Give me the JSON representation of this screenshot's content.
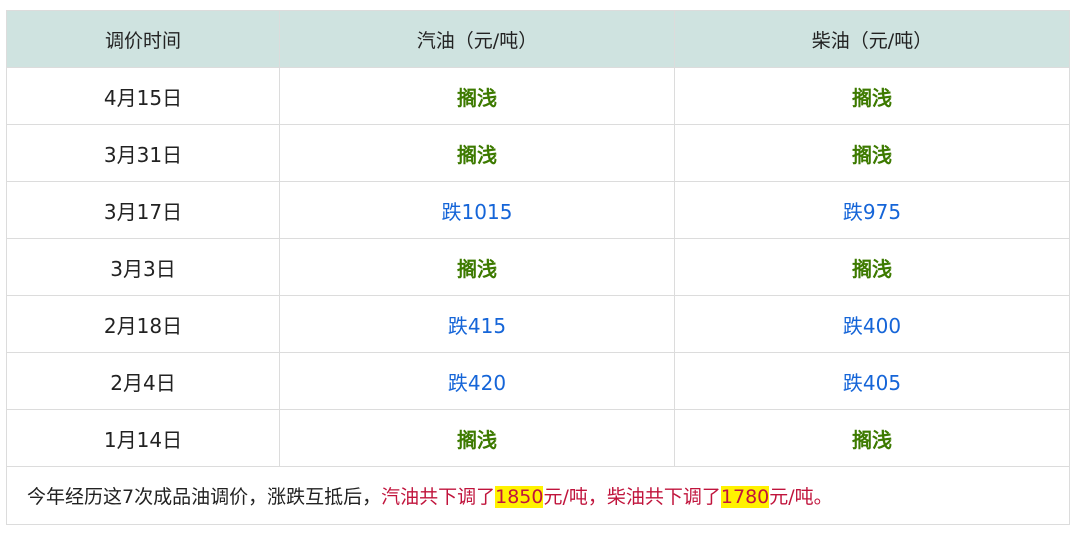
{
  "header": {
    "col_date": "调价时间",
    "col_gasoline": "汽油（元/吨）",
    "col_diesel": "柴油（元/吨）"
  },
  "rows": [
    {
      "date": "4月15日",
      "gasoline": "搁浅",
      "diesel": "搁浅"
    },
    {
      "date": "3月31日",
      "gasoline": "搁浅",
      "diesel": "搁浅"
    },
    {
      "date": "3月17日",
      "gasoline": "跌1015",
      "diesel": "跌975"
    },
    {
      "date": "3月3日",
      "gasoline": "搁浅",
      "diesel": "搁浅"
    },
    {
      "date": "2月18日",
      "gasoline": "跌415",
      "diesel": "跌400"
    },
    {
      "date": "2月4日",
      "gasoline": "跌420",
      "diesel": "跌405"
    },
    {
      "date": "1月14日",
      "gasoline": "搁浅",
      "diesel": "搁浅"
    }
  ],
  "summary": {
    "prefix": "今年经历这7次成品油调价，涨跌互抵后，",
    "gasoline_text": "汽油共下调了",
    "gasoline_value": "1850",
    "gasoline_unit": "元/吨，",
    "diesel_text": "柴油共下调了",
    "diesel_value": "1780",
    "diesel_unit": "元/吨。"
  },
  "colors": {
    "header_bg": "#cfe3e0",
    "stalled_green": "#3d7a00",
    "drop_blue": "#1565d8",
    "summary_red": "#c0143c",
    "highlight_yellow": "#fff200"
  }
}
